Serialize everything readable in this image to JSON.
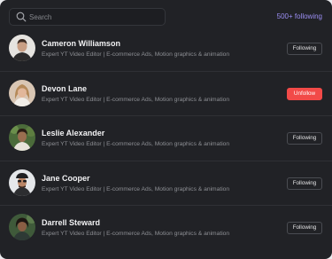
{
  "search": {
    "placeholder": "Search",
    "value": ""
  },
  "following_count": "500+ following",
  "colors": {
    "accent": "#9b8ef3",
    "unfollow": "#f24a48",
    "background": "#212226"
  },
  "users": [
    {
      "name": "Cameron Williamson",
      "description": "Expert YT Video Editor | E-commerce Ads, Motion graphics & animation",
      "button": "Following",
      "state": "following"
    },
    {
      "name": "Devon Lane",
      "description": "Expert YT Video Editor | E-commerce Ads, Motion graphics & animation",
      "button": "Unfollow",
      "state": "unfollow"
    },
    {
      "name": "Leslie Alexander",
      "description": "Expert YT Video Editor | E-commerce Ads, Motion graphics & animation",
      "button": "Following",
      "state": "following"
    },
    {
      "name": "Jane Cooper",
      "description": "Expert YT Video Editor | E-commerce Ads, Motion graphics & animation",
      "button": "Following",
      "state": "following"
    },
    {
      "name": "Darrell Steward",
      "description": "Expert YT Video Editor | E-commerce Ads, Motion graphics & animation",
      "button": "Following",
      "state": "following"
    }
  ]
}
